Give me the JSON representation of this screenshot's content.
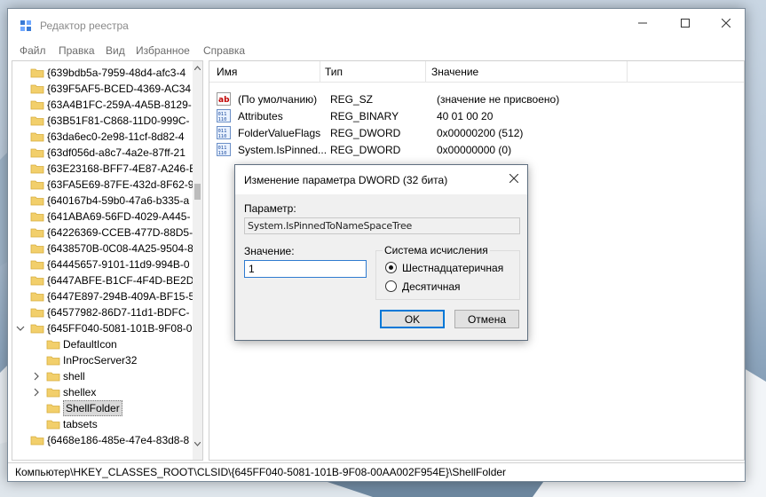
{
  "window": {
    "title": "Редактор реестра"
  },
  "menu": [
    "Файл",
    "Правка",
    "Вид",
    "Избранное",
    "Справка"
  ],
  "tree": {
    "items": [
      {
        "label": "{639bdb5a-7959-48d4-afc3-4",
        "indent": 0,
        "chevron": "none"
      },
      {
        "label": "{639F5AF5-BCED-4369-AC34",
        "indent": 0,
        "chevron": "none"
      },
      {
        "label": "{63A4B1FC-259A-4A5B-8129-",
        "indent": 0,
        "chevron": "none"
      },
      {
        "label": "{63B51F81-C868-11D0-999C-",
        "indent": 0,
        "chevron": "none"
      },
      {
        "label": "{63da6ec0-2e98-11cf-8d82-4",
        "indent": 0,
        "chevron": "none"
      },
      {
        "label": "{63df056d-a8c7-4a2e-87ff-21",
        "indent": 0,
        "chevron": "none"
      },
      {
        "label": "{63E23168-BFF7-4E87-A246-E",
        "indent": 0,
        "chevron": "none"
      },
      {
        "label": "{63FA5E69-87FE-432d-8F62-9",
        "indent": 0,
        "chevron": "none"
      },
      {
        "label": "{640167b4-59b0-47a6-b335-a",
        "indent": 0,
        "chevron": "none"
      },
      {
        "label": "{641ABA69-56FD-4029-A445-",
        "indent": 0,
        "chevron": "none"
      },
      {
        "label": "{64226369-CCEB-477D-88D5-",
        "indent": 0,
        "chevron": "none"
      },
      {
        "label": "{6438570B-0C08-4A25-9504-8",
        "indent": 0,
        "chevron": "none"
      },
      {
        "label": "{64445657-9101-11d9-994B-0",
        "indent": 0,
        "chevron": "none"
      },
      {
        "label": "{6447ABFE-B1CF-4F4D-BE2D",
        "indent": 0,
        "chevron": "none"
      },
      {
        "label": "{6447E897-294B-409A-BF15-5",
        "indent": 0,
        "chevron": "none"
      },
      {
        "label": "{64577982-86D7-11d1-BDFC-",
        "indent": 0,
        "chevron": "none"
      },
      {
        "label": "{645FF040-5081-101B-9F08-0",
        "indent": 0,
        "chevron": "expanded"
      },
      {
        "label": "DefaultIcon",
        "indent": 1,
        "chevron": "none"
      },
      {
        "label": "InProcServer32",
        "indent": 1,
        "chevron": "none"
      },
      {
        "label": "shell",
        "indent": 1,
        "chevron": "collapsed"
      },
      {
        "label": "shellex",
        "indent": 1,
        "chevron": "collapsed"
      },
      {
        "label": "ShellFolder",
        "indent": 1,
        "chevron": "none",
        "selected": true
      },
      {
        "label": "tabsets",
        "indent": 1,
        "chevron": "none"
      },
      {
        "label": "{6468e186-485e-47e4-83d8-8",
        "indent": 0,
        "chevron": "none"
      }
    ]
  },
  "list": {
    "columns": {
      "name": "Имя",
      "type": "Тип",
      "value": "Значение"
    },
    "rows": [
      {
        "icon": "string-value-icon",
        "name": "(По умолчанию)",
        "type": "REG_SZ",
        "value": "(значение не присвоено)"
      },
      {
        "icon": "binary-value-icon",
        "name": "Attributes",
        "type": "REG_BINARY",
        "value": "40 01 00 20"
      },
      {
        "icon": "binary-value-icon",
        "name": "FolderValueFlags",
        "type": "REG_DWORD",
        "value": "0x00000200 (512)"
      },
      {
        "icon": "binary-value-icon",
        "name": "System.IsPinned...",
        "type": "REG_DWORD",
        "value": "0x00000000 (0)"
      }
    ]
  },
  "status": {
    "path": "Компьютер\\HKEY_CLASSES_ROOT\\CLSID\\{645FF040-5081-101B-9F08-00AA002F954E}\\ShellFolder"
  },
  "dialog": {
    "title": "Изменение параметра DWORD (32 бита)",
    "param_label": "Параметр:",
    "param_value": "System.IsPinnedToNameSpaceTree",
    "value_label": "Значение:",
    "value": "1",
    "base_group": "Система исчисления",
    "radio_hex": "Шестнадцатеричная",
    "radio_dec": "Десятичная",
    "selected_base": "hex",
    "ok": "OK",
    "cancel": "Отмена"
  },
  "colors": {
    "folder": "#f2cf6b",
    "accent": "#0078d7"
  }
}
